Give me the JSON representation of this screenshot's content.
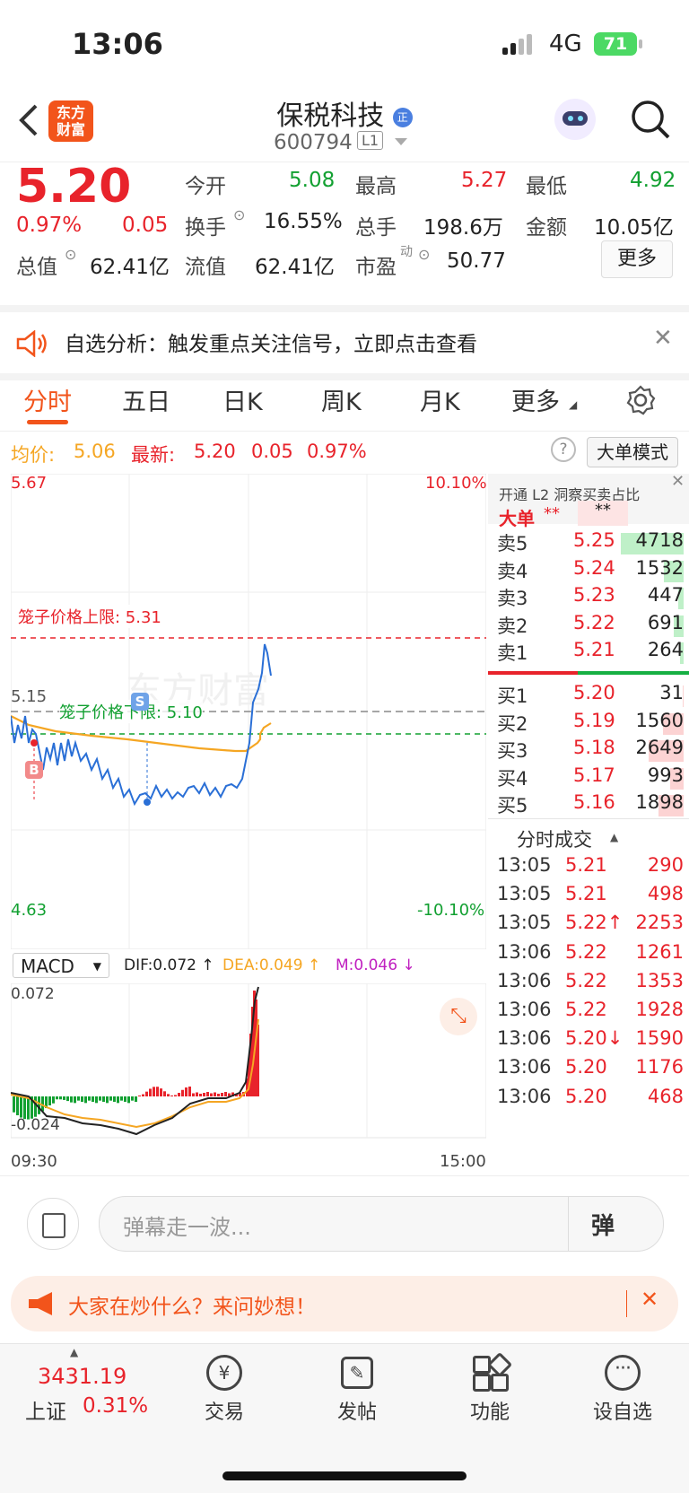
{
  "status_bar": {
    "time": "13:06",
    "network": "4G",
    "battery": "71"
  },
  "header": {
    "logo_line1": "东方",
    "logo_line2": "财富",
    "stock_name": "保税科技",
    "name_badge": "正",
    "code": "600794",
    "level": "L1"
  },
  "quote": {
    "price": "5.20",
    "change_pct": "0.97%",
    "change": "0.05",
    "open_label": "今开",
    "open": "5.08",
    "high_label": "最高",
    "high": "5.27",
    "low_label": "最低",
    "low": "4.92",
    "turnover_label": "换手",
    "turnover": "16.55%",
    "volume_label": "总手",
    "volume": "198.6万",
    "amount_label": "金额",
    "amount": "10.05亿",
    "mktcap_label": "总值",
    "mktcap": "62.41亿",
    "float_label": "流值",
    "float_cap": "62.41亿",
    "pe_label": "市盈",
    "pe_sup": "动",
    "pe": "50.77",
    "more_button": "更多"
  },
  "alert": {
    "text": "自选分析：触发重点关注信号，立即点击查看"
  },
  "tabs": [
    "分时",
    "五日",
    "日K",
    "周K",
    "月K",
    "更多"
  ],
  "avg_bar": {
    "avg_label": "均价:",
    "avg_value": "5.06",
    "latest_label": "最新:",
    "latest_value": "5.20",
    "latest_change": "0.05",
    "latest_pct": "0.97%",
    "mode_button": "大单模式"
  },
  "chart": {
    "y_top": "5.67",
    "y_bottom": "4.63",
    "pct_top": "10.10%",
    "pct_bottom": "-10.10%",
    "ref_price": "5.15",
    "upper_limit_label": "笼子价格上限: 5.31",
    "lower_limit_label": "笼子价格下限: 5.10",
    "marker_b": "B",
    "marker_s": "S",
    "watermark": "东方财富"
  },
  "macd": {
    "selector": "MACD",
    "dif": "DIF:0.072 ↑",
    "dea": "DEA:0.049 ↑",
    "m": "M:0.046 ↓",
    "top_value": "0.072",
    "bottom_value": "-0.024",
    "time_start": "09:30",
    "time_end": "15:00"
  },
  "order_book": {
    "l2_promo": "开通 L2 洞察买卖占比",
    "big_order_label": "大单",
    "big_order_v1": "**",
    "big_order_v2": "**",
    "asks": [
      {
        "label": "卖5",
        "price": "5.25",
        "vol": "4718",
        "fill": 1.0
      },
      {
        "label": "卖4",
        "price": "5.24",
        "vol": "1532",
        "fill": 0.32
      },
      {
        "label": "卖3",
        "price": "5.23",
        "vol": "447",
        "fill": 0.09
      },
      {
        "label": "卖2",
        "price": "5.22",
        "vol": "691",
        "fill": 0.15
      },
      {
        "label": "卖1",
        "price": "5.21",
        "vol": "264",
        "fill": 0.06
      }
    ],
    "bids": [
      {
        "label": "买1",
        "price": "5.20",
        "vol": "31",
        "fill": 0.01
      },
      {
        "label": "买2",
        "price": "5.19",
        "vol": "1560",
        "fill": 0.33
      },
      {
        "label": "买3",
        "price": "5.18",
        "vol": "2649",
        "fill": 0.56
      },
      {
        "label": "买4",
        "price": "5.17",
        "vol": "993",
        "fill": 0.21
      },
      {
        "label": "买5",
        "price": "5.16",
        "vol": "1898",
        "fill": 0.4
      }
    ],
    "trades_title": "分时成交",
    "trades": [
      {
        "time": "13:05",
        "price": "5.21",
        "vol": "290"
      },
      {
        "time": "13:05",
        "price": "5.21",
        "vol": "498"
      },
      {
        "time": "13:05",
        "price": "5.22↑",
        "vol": "2253"
      },
      {
        "time": "13:06",
        "price": "5.22",
        "vol": "1261"
      },
      {
        "time": "13:06",
        "price": "5.22",
        "vol": "1353"
      },
      {
        "time": "13:06",
        "price": "5.22",
        "vol": "1928"
      },
      {
        "time": "13:06",
        "price": "5.20↓",
        "vol": "1590"
      },
      {
        "time": "13:06",
        "price": "5.20",
        "vol": "1176"
      },
      {
        "time": "13:06",
        "price": "5.20",
        "vol": "468"
      }
    ]
  },
  "danmu": {
    "placeholder": "弹幕走一波...",
    "send": "弹"
  },
  "promo": {
    "text": "大家在炒什么？来问妙想！"
  },
  "bottom_nav": {
    "index_value": "3431.19",
    "index_name": "上证",
    "index_pct": "0.31%",
    "trade": "交易",
    "post": "发帖",
    "functions": "功能",
    "add_watch": "设自选"
  },
  "colors": {
    "up": "#e8232b",
    "down": "#12a031",
    "avg_line": "#f5a623",
    "price_line": "#2a6fd6",
    "brand": "#f2541b"
  }
}
